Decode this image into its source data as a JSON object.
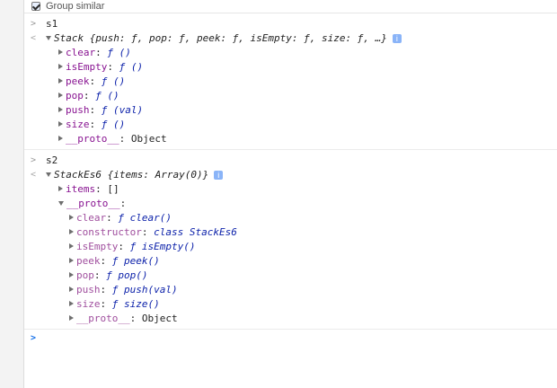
{
  "toolbar": {
    "group_similar_label": "Group similar"
  },
  "entries": [
    {
      "input": "s1",
      "summary": {
        "ctor": "Stack",
        "preview": " {push: ƒ, pop: ƒ, peek: ƒ, isEmpty: ƒ, size: ƒ, …}"
      },
      "props": [
        {
          "key": "clear",
          "sep": ": ",
          "val": "ƒ ()"
        },
        {
          "key": "isEmpty",
          "sep": ": ",
          "val": "ƒ ()"
        },
        {
          "key": "peek",
          "sep": ": ",
          "val": "ƒ ()"
        },
        {
          "key": "pop",
          "sep": ": ",
          "val": "ƒ ()"
        },
        {
          "key": "push",
          "sep": ": ",
          "val": "ƒ (val)"
        },
        {
          "key": "size",
          "sep": ": ",
          "val": "ƒ ()"
        },
        {
          "key": "__proto__",
          "sep": ": ",
          "val": "Object"
        }
      ]
    },
    {
      "input": "s2",
      "summary": {
        "ctor": "StackEs6",
        "preview": " {items: Array(0)}"
      },
      "props": [
        {
          "key": "items",
          "sep": ": ",
          "val": "[]"
        },
        {
          "key": "__proto__",
          "sep": ":",
          "val": ""
        }
      ],
      "proto_props": [
        {
          "key": "clear",
          "sep": ": ",
          "val": "ƒ clear()"
        },
        {
          "key": "constructor",
          "sep": ": ",
          "val": "class StackEs6"
        },
        {
          "key": "isEmpty",
          "sep": ": ",
          "val": "ƒ isEmpty()"
        },
        {
          "key": "peek",
          "sep": ": ",
          "val": "ƒ peek()"
        },
        {
          "key": "pop",
          "sep": ": ",
          "val": "ƒ pop()"
        },
        {
          "key": "push",
          "sep": ": ",
          "val": "ƒ push(val)"
        },
        {
          "key": "size",
          "sep": ": ",
          "val": "ƒ size()"
        },
        {
          "key": "__proto__",
          "sep": ": ",
          "val": "Object"
        }
      ]
    }
  ],
  "prompt_symbol": ">",
  "output_symbol": "<",
  "info_symbol": "i"
}
